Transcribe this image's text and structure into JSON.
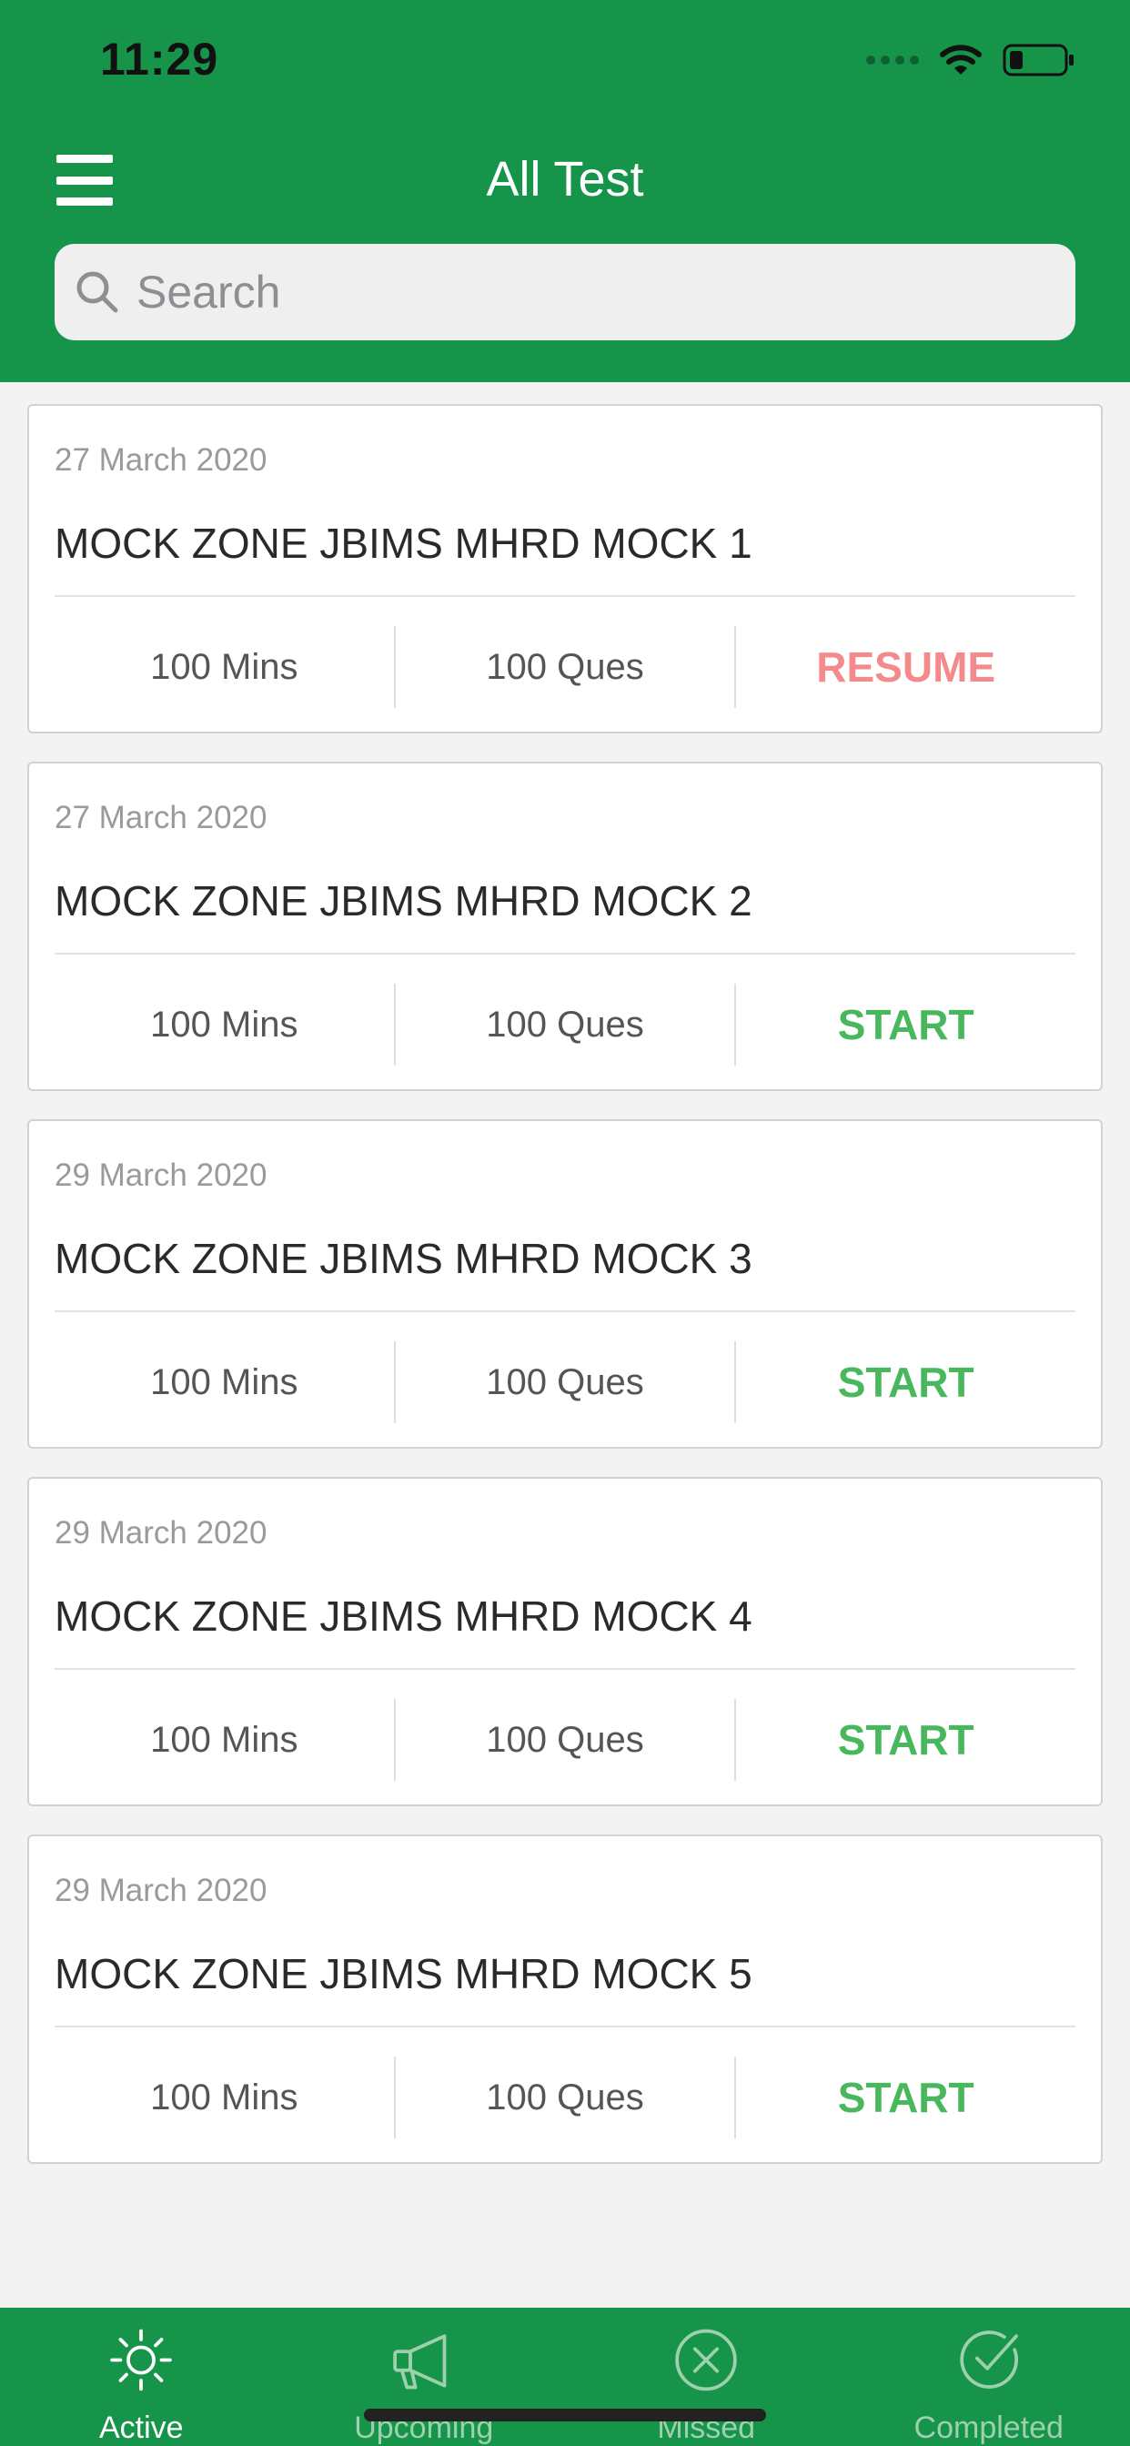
{
  "status_bar": {
    "time": "11:29"
  },
  "header": {
    "title": "All Test",
    "search_placeholder": "Search"
  },
  "tests": [
    {
      "date": "27 March 2020",
      "title": "MOCK ZONE JBIMS MHRD MOCK 1",
      "duration": "100 Mins",
      "questions": "100 Ques",
      "action": "RESUME",
      "action_type": "resume"
    },
    {
      "date": "27 March 2020",
      "title": "MOCK ZONE JBIMS MHRD MOCK 2",
      "duration": "100 Mins",
      "questions": "100 Ques",
      "action": "START",
      "action_type": "start"
    },
    {
      "date": "29 March 2020",
      "title": "MOCK ZONE JBIMS MHRD MOCK 3",
      "duration": "100 Mins",
      "questions": "100 Ques",
      "action": "START",
      "action_type": "start"
    },
    {
      "date": "29 March 2020",
      "title": "MOCK ZONE JBIMS MHRD MOCK 4",
      "duration": "100 Mins",
      "questions": "100 Ques",
      "action": "START",
      "action_type": "start"
    },
    {
      "date": "29 March 2020",
      "title": "MOCK ZONE JBIMS MHRD MOCK 5",
      "duration": "100 Mins",
      "questions": "100 Ques",
      "action": "START",
      "action_type": "start"
    }
  ],
  "tabbar": {
    "tabs": [
      {
        "label": "Active",
        "icon": "sun-icon",
        "active": true
      },
      {
        "label": "Upcoming",
        "icon": "megaphone-icon",
        "active": false
      },
      {
        "label": "Missed",
        "icon": "circle-x-icon",
        "active": false
      },
      {
        "label": "Completed",
        "icon": "circle-check-icon",
        "active": false
      }
    ]
  },
  "colors": {
    "brand_green": "#16944a",
    "resume": "#f48a8c",
    "start": "#49b85c",
    "tab_inactive": "#9fd0ad"
  }
}
